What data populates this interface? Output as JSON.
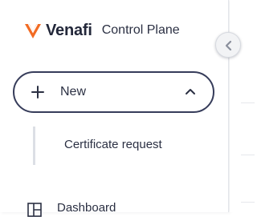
{
  "brand": {
    "name": "Venafi",
    "product": "Control Plane",
    "logo_icon": "venafi-v-logo",
    "logo_color": "#f26b23"
  },
  "new_menu": {
    "label": "New",
    "plus_icon": "plus-icon",
    "toggle_icon": "chevron-up-icon",
    "expanded": true,
    "items": [
      {
        "label": "Certificate request"
      }
    ]
  },
  "nav": {
    "items": [
      {
        "label": "Dashboard",
        "icon": "dashboard-icon"
      }
    ]
  },
  "collapse_toggle": {
    "icon": "chevron-left-icon"
  },
  "colors": {
    "accent_orange": "#f26b23",
    "text_dark": "#2b3043",
    "button_border": "#363c5a",
    "submenu_line": "#dcdfe5"
  }
}
